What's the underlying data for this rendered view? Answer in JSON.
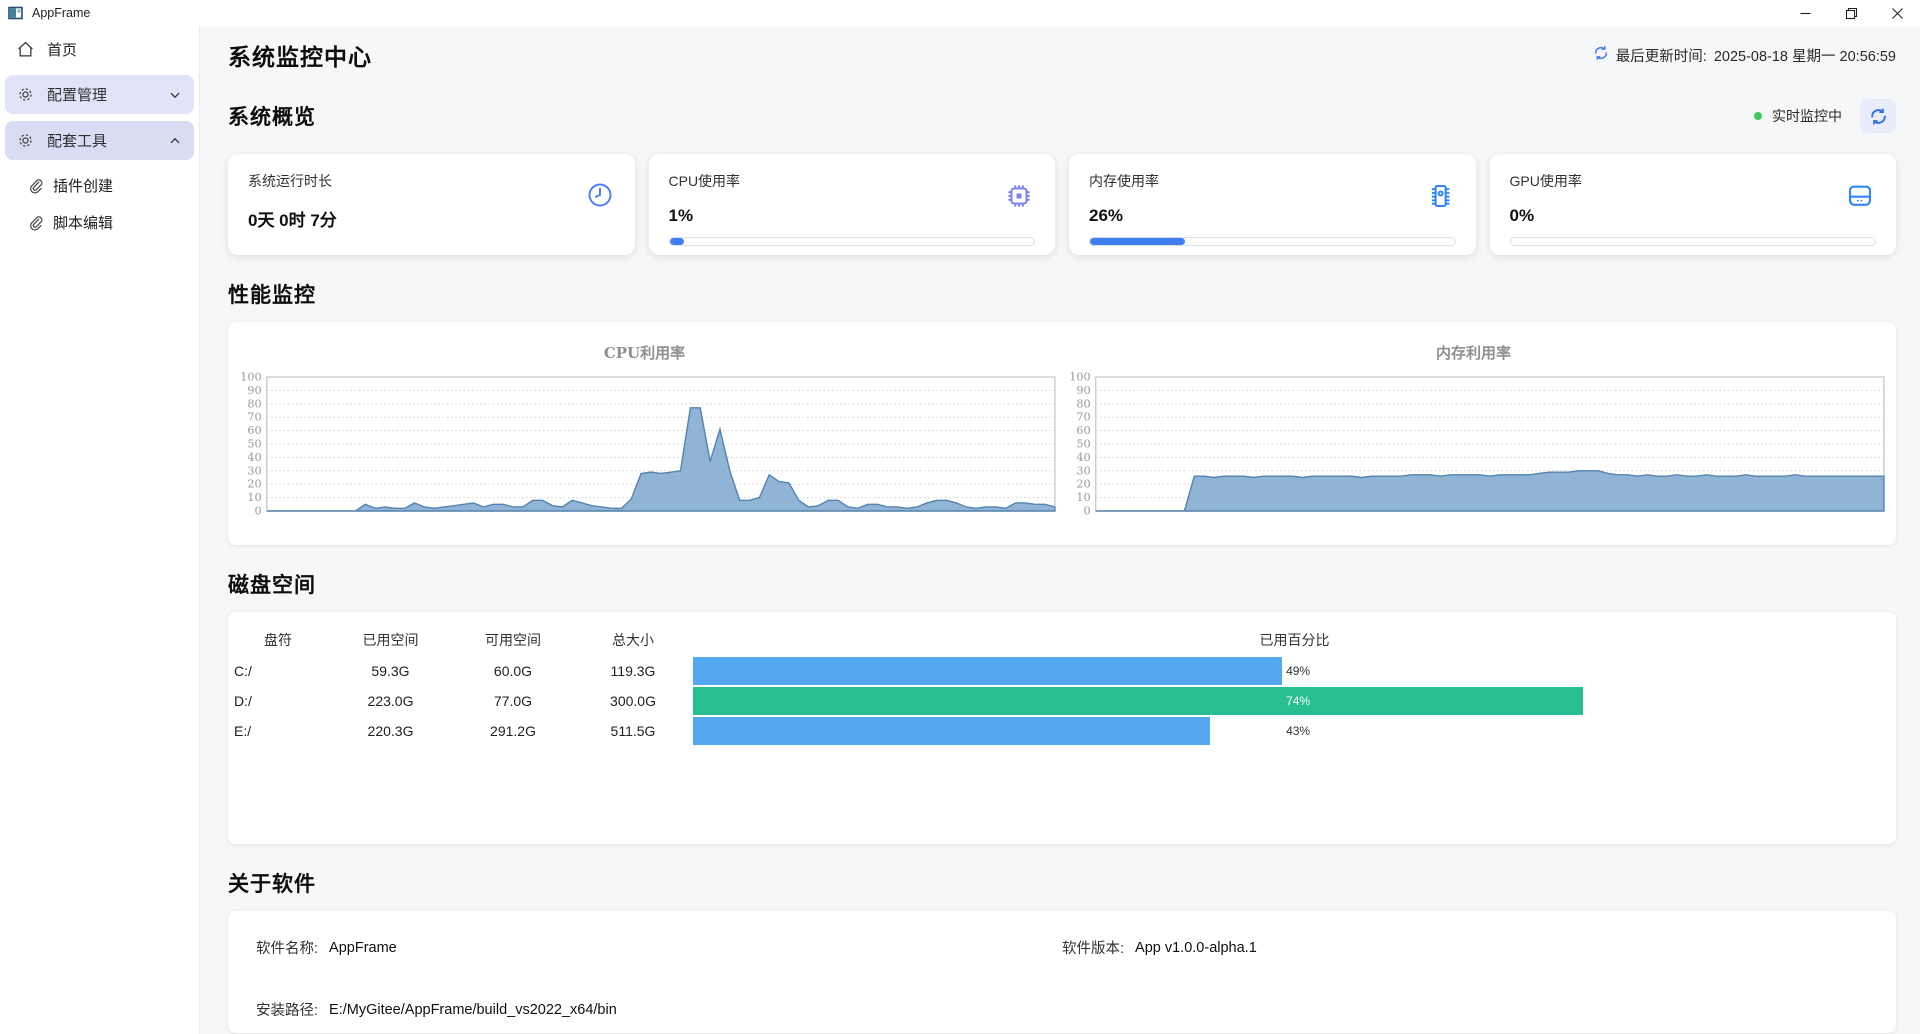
{
  "window": {
    "title": "AppFrame",
    "controls": {
      "minimize": "minimize",
      "restore": "restore",
      "close": "close"
    }
  },
  "sidebar": {
    "home": {
      "label": "首页",
      "icon": "home-icon"
    },
    "groups": [
      {
        "label": "配置管理",
        "icon": "gear-icon",
        "state": "collapsed"
      },
      {
        "label": "配套工具",
        "icon": "gear-icon",
        "state": "expanded"
      }
    ],
    "sub_items": [
      {
        "label": "插件创建",
        "icon": "paperclip-icon"
      },
      {
        "label": "脚本编辑",
        "icon": "paperclip-icon"
      }
    ]
  },
  "header": {
    "title": "系统监控中心",
    "last_update_label": "最后更新时间:",
    "last_update_value": "2025-08-18 星期一 20:56:59"
  },
  "overview": {
    "heading": "系统概览",
    "live_status": "实时监控中",
    "live_dot_color": "#3ec75e",
    "cards": [
      {
        "title": "系统运行时长",
        "value": "0天 0时 7分",
        "icon": "clock-icon",
        "percent": null
      },
      {
        "title": "CPU使用率",
        "value": "1%",
        "icon": "cpu-chip-icon",
        "percent": 1
      },
      {
        "title": "内存使用率",
        "value": "26%",
        "icon": "memory-chip-icon",
        "percent": 26
      },
      {
        "title": "GPU使用率",
        "value": "0%",
        "icon": "gpu-drive-icon",
        "percent": 0
      }
    ],
    "progress_color": "#3f7ef2"
  },
  "performance": {
    "heading": "性能监控"
  },
  "chart_data": [
    {
      "type": "area",
      "title": "CPU利用率",
      "ylim": [
        0,
        100
      ],
      "yticks": [
        0,
        10,
        20,
        30,
        40,
        50,
        60,
        70,
        80,
        90,
        100
      ],
      "grid": true,
      "legend": "none",
      "fill_color": "#7ba7cf",
      "line_color": "#5684ae",
      "values": [
        0,
        0,
        0,
        0,
        0,
        0,
        0,
        0,
        0,
        0,
        5,
        2,
        3,
        2,
        2,
        6,
        3,
        2,
        3,
        4,
        5,
        6,
        3,
        5,
        5,
        3,
        3,
        8,
        8,
        4,
        3,
        8,
        6,
        4,
        3,
        2,
        2,
        9,
        28,
        29,
        28,
        29,
        30,
        77,
        77,
        37,
        61,
        30,
        8,
        8,
        10,
        27,
        22,
        21,
        8,
        3,
        4,
        8,
        8,
        3,
        2,
        5,
        5,
        3,
        3,
        2,
        3,
        6,
        8,
        8,
        6,
        3,
        2,
        3,
        3,
        2,
        6,
        6,
        5,
        5,
        3
      ]
    },
    {
      "type": "area",
      "title": "内存利用率",
      "ylim": [
        0,
        100
      ],
      "yticks": [
        0,
        10,
        20,
        30,
        40,
        50,
        60,
        70,
        80,
        90,
        100
      ],
      "grid": true,
      "legend": "none",
      "fill_color": "#7ba7cf",
      "line_color": "#5684ae",
      "values": [
        0,
        0,
        0,
        0,
        0,
        0,
        0,
        0,
        0,
        0,
        26,
        26,
        25,
        26,
        26,
        26,
        25,
        26,
        26,
        26,
        26,
        25,
        26,
        26,
        26,
        26,
        26,
        25,
        26,
        26,
        26,
        26,
        27,
        27,
        27,
        26,
        27,
        27,
        27,
        27,
        26,
        27,
        27,
        27,
        27,
        28,
        29,
        29,
        29,
        30,
        30,
        30,
        28,
        27,
        27,
        26,
        27,
        26,
        26,
        27,
        26,
        26,
        27,
        26,
        26,
        26,
        27,
        26,
        26,
        26,
        26,
        27,
        26,
        26,
        26,
        26,
        26,
        26,
        26,
        26,
        26
      ]
    }
  ],
  "disk": {
    "heading": "磁盘空间",
    "columns": [
      "盘符",
      "已用空间",
      "可用空间",
      "总大小",
      "已用百分比"
    ],
    "rows": [
      {
        "drive": "C:/",
        "used": "59.3G",
        "free": "60.0G",
        "total": "119.3G",
        "percent": 49,
        "percent_label": "49%",
        "bar_color": "#54a8f0"
      },
      {
        "drive": "D:/",
        "used": "223.0G",
        "free": "77.0G",
        "total": "300.0G",
        "percent": 74,
        "percent_label": "74%",
        "bar_color": "#27bf92"
      },
      {
        "drive": "E:/",
        "used": "220.3G",
        "free": "291.2G",
        "total": "511.5G",
        "percent": 43,
        "percent_label": "43%",
        "bar_color": "#54a8f0"
      }
    ]
  },
  "about": {
    "heading": "关于软件",
    "name_label": "软件名称:",
    "name_value": "AppFrame",
    "version_label": "软件版本:",
    "version_value": "App v1.0.0-alpha.1",
    "path_label": "安装路径:",
    "path_value": "E:/MyGitee/AppFrame/build_vs2022_x64/bin"
  }
}
